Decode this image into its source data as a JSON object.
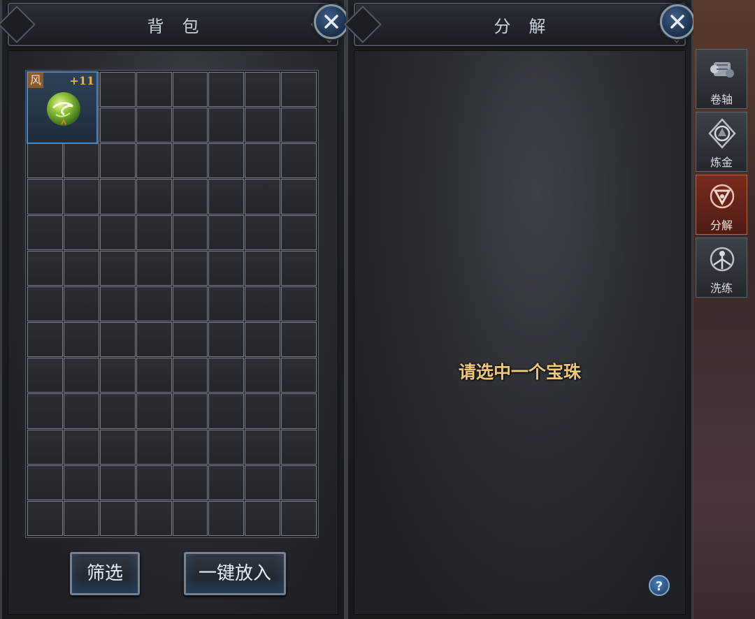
{
  "bag": {
    "title": "背包",
    "close_label": "✕",
    "item": {
      "tag": "风",
      "level": "+11",
      "icon": "green-wind-orb-icon"
    },
    "filter_label": "筛选",
    "put_all_label": "一键放入"
  },
  "decompose": {
    "title": "分解",
    "close_label": "✕",
    "prompt": "请选中一个宝珠",
    "help_label": "?"
  },
  "side_tabs": [
    {
      "label": "卷轴",
      "icon": "scroll-icon",
      "active": false
    },
    {
      "label": "炼金",
      "icon": "alchemy-icon",
      "active": false
    },
    {
      "label": "分解",
      "icon": "decompose-icon",
      "active": true
    },
    {
      "label": "洗练",
      "icon": "refine-icon",
      "active": false
    }
  ],
  "colors": {
    "accent_gold": "#f0c677",
    "level_orange": "#f3b13b",
    "slot_blue": "#4e86c3",
    "active_tab": "#7a2a1c"
  }
}
